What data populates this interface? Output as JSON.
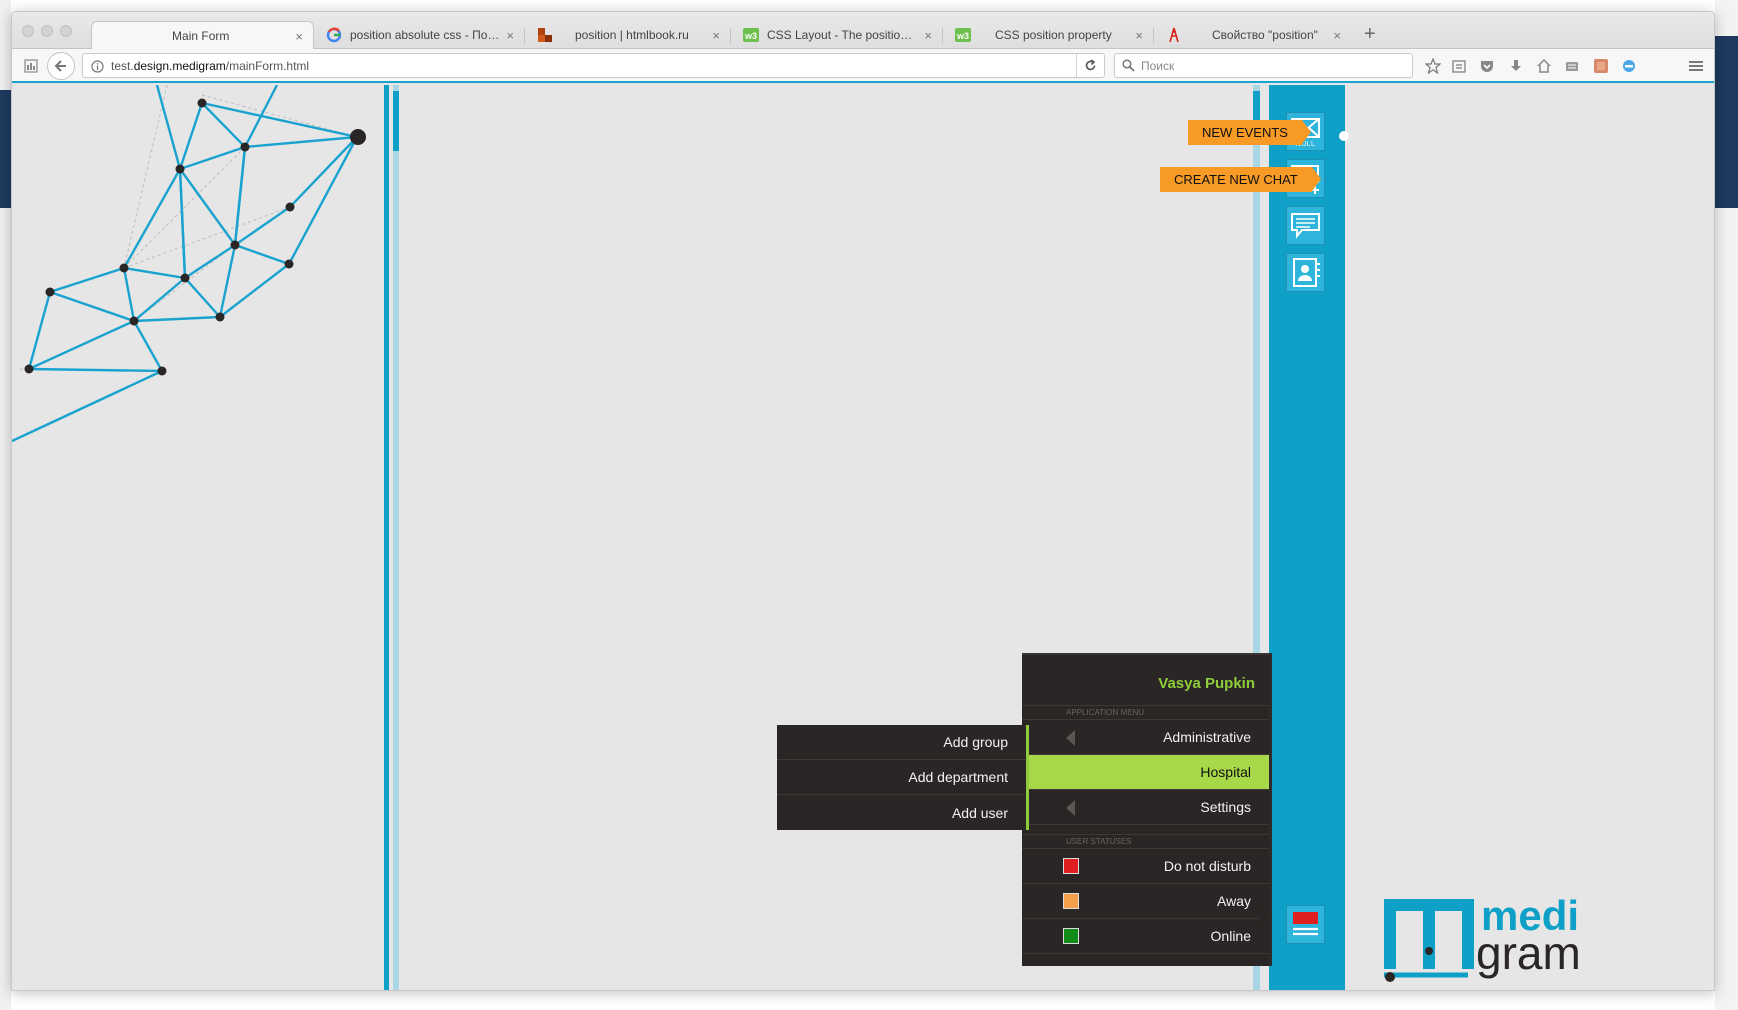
{
  "browser": {
    "tabs": [
      {
        "label": "Main Form",
        "favicon": "none",
        "active": true
      },
      {
        "label": "position absolute css - Пои...",
        "favicon": "google-icon"
      },
      {
        "label": "position | htmlbook.ru",
        "favicon": "htmlbook-icon"
      },
      {
        "label": "CSS Layout - The position ...",
        "favicon": "w3schools-icon"
      },
      {
        "label": "CSS position property",
        "favicon": "w3schools-icon"
      },
      {
        "label": "Свойство \"position\"",
        "favicon": "tower-icon"
      }
    ],
    "new_tab_label": "+",
    "tab_close_glyph": "×",
    "url_prefix": "test.",
    "url_domain": "design.medigram",
    "url_path": "/mainForm.html",
    "search_placeholder": "Поиск"
  },
  "side_panel": {
    "new_events_label": "NEW EVENTS",
    "create_chat_label": "CREATE NEW CHAT",
    "envelope_badge": "NULL",
    "colors": {
      "panel": "#0fa0c8",
      "tag": "#f79b26"
    }
  },
  "user_menu": {
    "user_name": "Vasya Pupkin",
    "app_menu_label": "APPLICATION MENU",
    "app_items": [
      {
        "label": "Administrative",
        "has_submenu": true
      },
      {
        "label": "Hospital",
        "highlighted": true
      },
      {
        "label": "Settings",
        "has_submenu": true
      }
    ],
    "status_label": "USER STATUSES",
    "statuses": [
      {
        "label": "Do not disturb",
        "color": "#e02020"
      },
      {
        "label": "Away",
        "color": "#f5a04a"
      },
      {
        "label": "Online",
        "color": "#118a18"
      }
    ],
    "highlight_color": "#a6d84a"
  },
  "sub_menu": {
    "items": [
      {
        "label": "Add group"
      },
      {
        "label": "Add department"
      },
      {
        "label": "Add user"
      }
    ]
  },
  "logo": {
    "line1": "medi",
    "line2": "gram",
    "color": "#0fa0c8"
  }
}
